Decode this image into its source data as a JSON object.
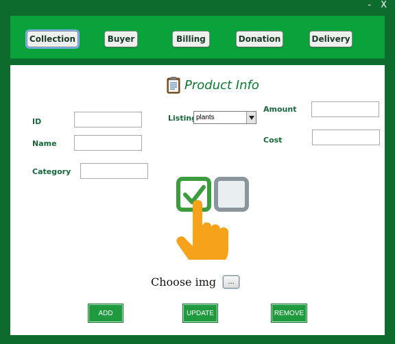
{
  "window": {
    "minimize_label": "-",
    "close_label": "X"
  },
  "nav": {
    "items": [
      {
        "label": "Collection"
      },
      {
        "label": "Buyer"
      },
      {
        "label": "Billing"
      },
      {
        "label": "Donation"
      },
      {
        "label": "Delivery"
      }
    ]
  },
  "panel": {
    "title": "Product Info",
    "labels": {
      "id": "ID",
      "name": "Name",
      "category": "Category",
      "listing": "Listing",
      "amount": "Amount",
      "cost": "Cost"
    },
    "fields": {
      "id": "",
      "name": "",
      "category": "",
      "amount": "",
      "cost": ""
    },
    "listing_selected": "plants",
    "choose_img_label": "Choose img",
    "browse_label": "...",
    "actions": {
      "add": "ADD",
      "update": "UPDATE",
      "remove": "REMOVE"
    }
  },
  "colors": {
    "frame": "#0e6b2e",
    "topbar": "#0aa33b",
    "label_green": "#16663a",
    "title_green": "#0a7a30",
    "button_green": "#1f9a3f",
    "check_green": "#3c9b3c",
    "hand_orange": "#f6a21a"
  },
  "icons": {
    "title": "clipboard-icon",
    "dropdown": "chevron-down-icon",
    "graphic": "checkbox-hand-illustration"
  }
}
